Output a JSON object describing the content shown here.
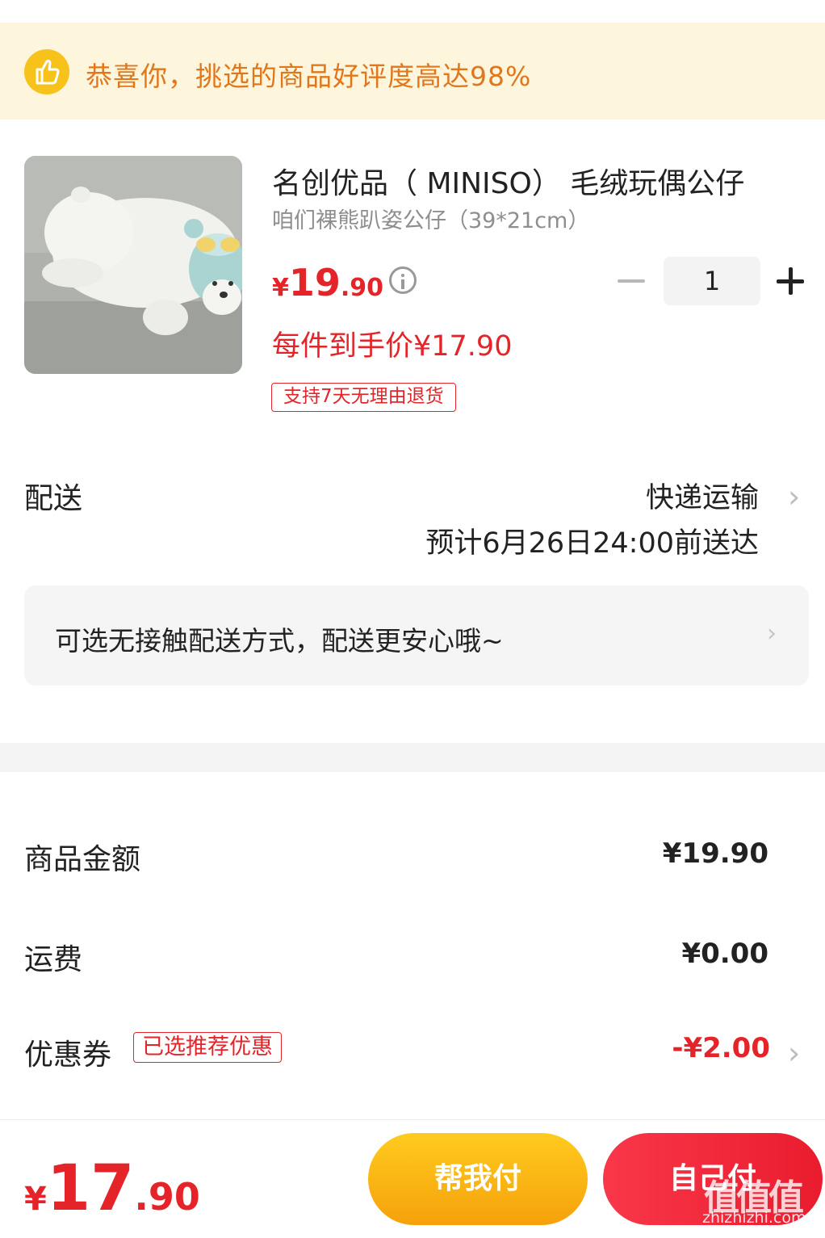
{
  "banner": {
    "icon": "thumbs-up-icon",
    "text": "恭喜你，挑选的商品好评度高达98%"
  },
  "product": {
    "title": "名创优品（ MINISO） 毛绒玩偶公仔",
    "spec": "咱们裸熊趴姿公仔（39*21cm）",
    "price_currency": "¥",
    "price_int": "19",
    "price_dec": ".90",
    "final_price": "每件到手价¥17.90",
    "return_tag": "支持7天无理由退货",
    "quantity": "1"
  },
  "delivery": {
    "label": "配送",
    "method": "快递运输",
    "eta": "预计6月26日24:00前送达",
    "chevron": "›"
  },
  "contactless": {
    "text": "可选无接触配送方式，配送更安心哦~",
    "chevron": "›"
  },
  "summary": {
    "goods_label": "商品金额",
    "goods_value": "¥19.90",
    "shipping_label": "运费",
    "shipping_value": "¥0.00",
    "coupon_label": "优惠券",
    "coupon_tag": "已选推荐优惠",
    "coupon_value": "-¥2.00",
    "chevron": "›"
  },
  "bottom": {
    "total_currency": "¥",
    "total_int": "17",
    "total_dec": ".90",
    "help_pay_label": "帮我付",
    "self_pay_label": "自己付"
  },
  "watermark": {
    "logo": "值值值",
    "site": "zhizhizhi.com"
  },
  "colors": {
    "accent_red": "#e5242a",
    "banner_bg": "#fdf6dc",
    "banner_text": "#e1771d",
    "help_button": "#f9b714",
    "self_button": "#f12c3e"
  }
}
